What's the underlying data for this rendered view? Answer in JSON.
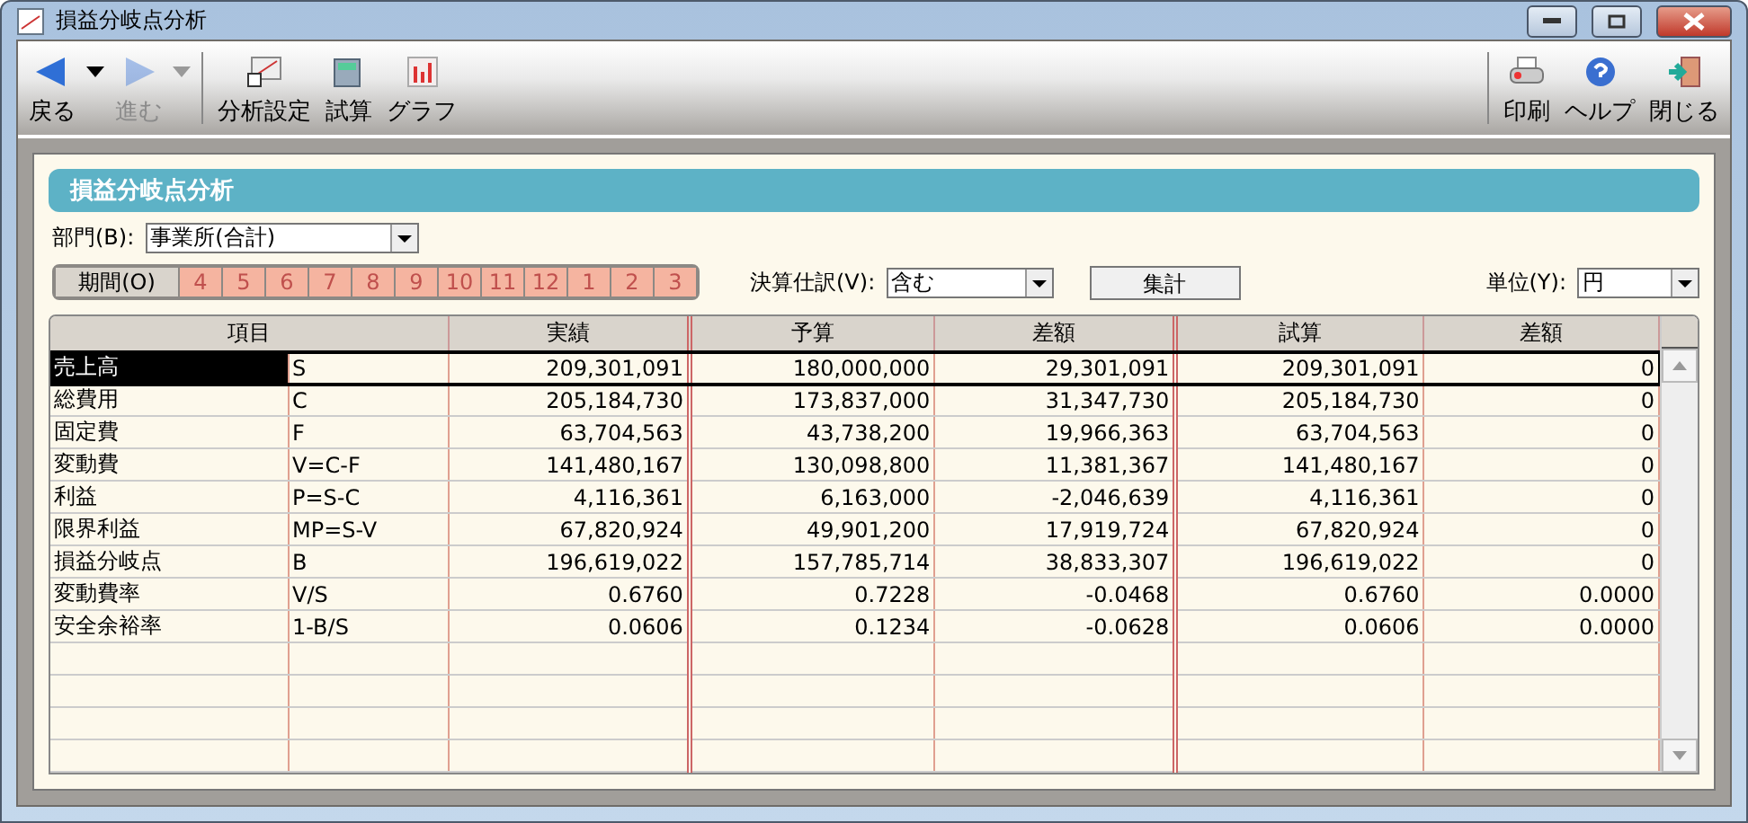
{
  "window": {
    "title": "損益分岐点分析"
  },
  "toolbar": {
    "left": [
      {
        "label": "戻る",
        "kind": "back",
        "disabled": false,
        "dropdown": true
      },
      {
        "label": "進む",
        "kind": "forward",
        "disabled": true,
        "dropdown": true
      },
      {
        "label": "分析設定",
        "kind": "settings",
        "disabled": false,
        "dropdown": false
      },
      {
        "label": "試算",
        "kind": "calc",
        "disabled": false,
        "dropdown": false
      },
      {
        "label": "グラフ",
        "kind": "graph",
        "disabled": false,
        "dropdown": false
      }
    ],
    "right": [
      {
        "label": "印刷",
        "kind": "print",
        "disabled": false,
        "dropdown": false
      },
      {
        "label": "ヘルプ",
        "kind": "help",
        "disabled": false,
        "dropdown": false
      },
      {
        "label": "閉じる",
        "kind": "close",
        "disabled": false,
        "dropdown": false
      }
    ]
  },
  "panel_title": "損益分岐点分析",
  "department": {
    "label": "部門(B):",
    "value": "事業所(合計)"
  },
  "period": {
    "label": "期間(O)",
    "months": [
      "4",
      "5",
      "6",
      "7",
      "8",
      "9",
      "10",
      "11",
      "12",
      "1",
      "2",
      "3"
    ]
  },
  "closing_entries": {
    "label": "決算仕訳(V):",
    "value": "含む"
  },
  "aggregate_button": "集計",
  "unit": {
    "label": "単位(Y):",
    "value": "円"
  },
  "table": {
    "columns": [
      {
        "label": "項目",
        "kind": "double",
        "colspan": 2
      },
      {
        "label": "実績",
        "kind": "single"
      },
      {
        "label": "予算",
        "kind": "single"
      },
      {
        "label": "差額",
        "kind": "single"
      },
      {
        "label": "試算",
        "kind": "single"
      },
      {
        "label": "差額",
        "kind": "single"
      }
    ],
    "rows": [
      {
        "selected": true,
        "cells": [
          "売上高",
          "S",
          "209,301,091",
          "180,000,000",
          "29,301,091",
          "209,301,091",
          "0"
        ]
      },
      {
        "selected": false,
        "cells": [
          "総費用",
          "C",
          "205,184,730",
          "173,837,000",
          "31,347,730",
          "205,184,730",
          "0"
        ]
      },
      {
        "selected": false,
        "cells": [
          "固定費",
          "F",
          "63,704,563",
          "43,738,200",
          "19,966,363",
          "63,704,563",
          "0"
        ]
      },
      {
        "selected": false,
        "cells": [
          "変動費",
          "V=C-F",
          "141,480,167",
          "130,098,800",
          "11,381,367",
          "141,480,167",
          "0"
        ]
      },
      {
        "selected": false,
        "cells": [
          "利益",
          "P=S-C",
          "4,116,361",
          "6,163,000",
          "-2,046,639",
          "4,116,361",
          "0"
        ]
      },
      {
        "selected": false,
        "cells": [
          "限界利益",
          "MP=S-V",
          "67,820,924",
          "49,901,200",
          "17,919,724",
          "67,820,924",
          "0"
        ]
      },
      {
        "selected": false,
        "cells": [
          "損益分岐点",
          "B",
          "196,619,022",
          "157,785,714",
          "38,833,307",
          "196,619,022",
          "0"
        ]
      },
      {
        "selected": false,
        "cells": [
          "変動費率",
          "V/S",
          "0.6760",
          "0.7228",
          "-0.0468",
          "0.6760",
          "0.0000"
        ]
      },
      {
        "selected": false,
        "cells": [
          "安全余裕率",
          "1-B/S",
          "0.0606",
          "0.1234",
          "-0.0628",
          "0.0606",
          "0.0000"
        ]
      }
    ]
  }
}
